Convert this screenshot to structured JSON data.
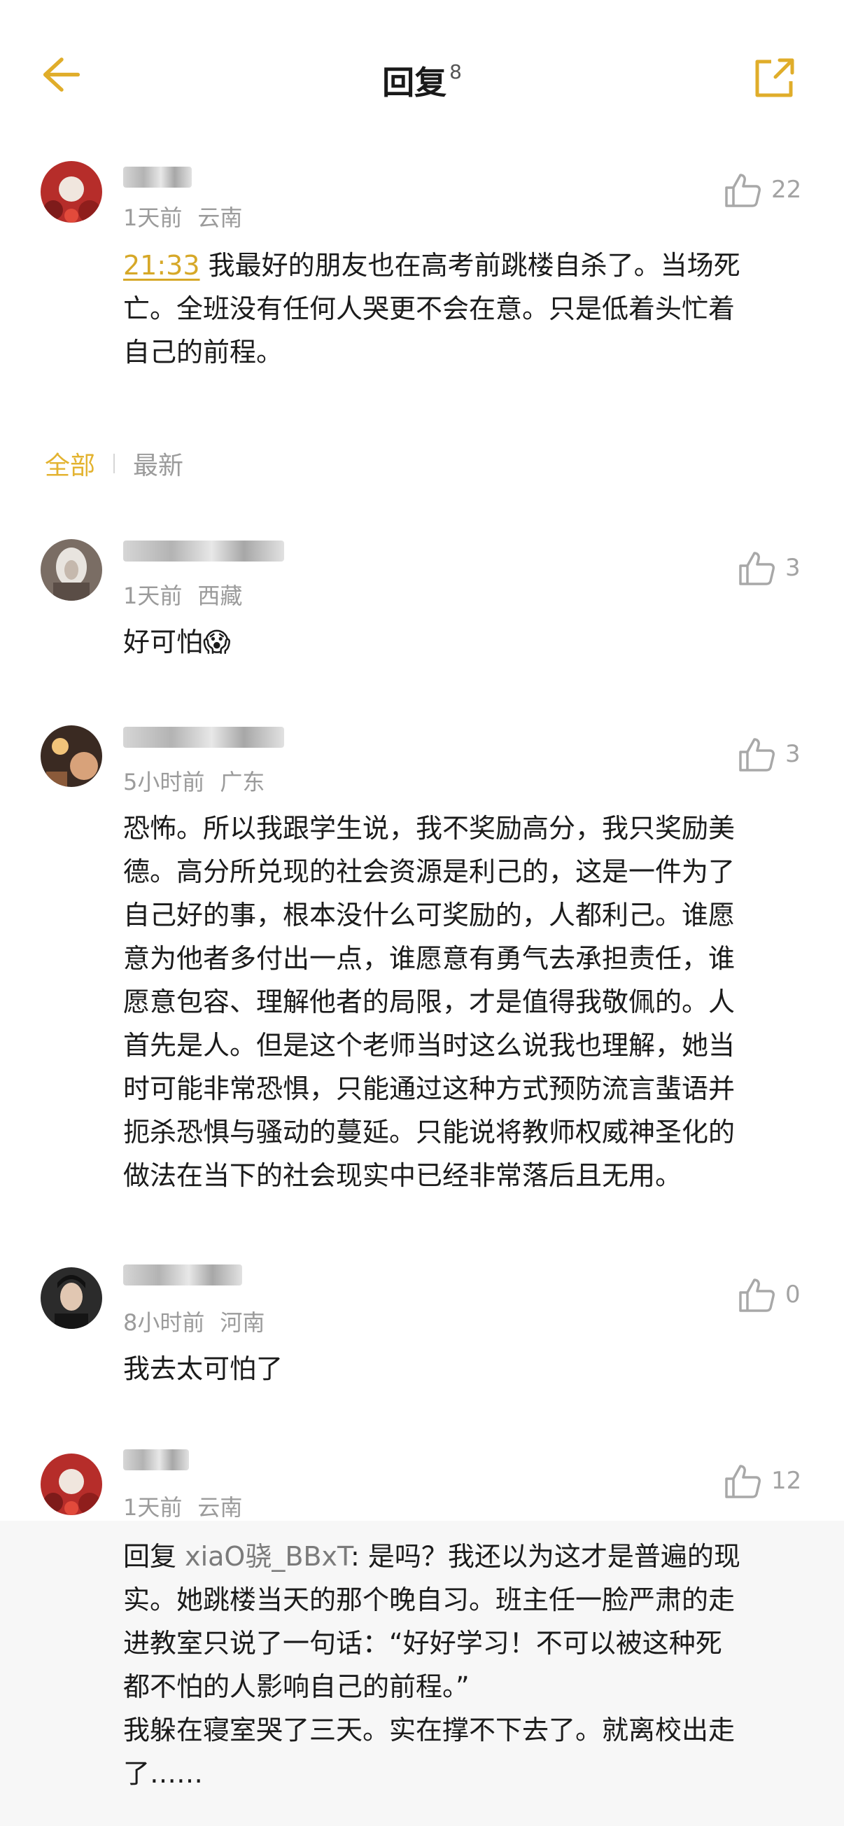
{
  "header": {
    "title": "回复",
    "count": "8"
  },
  "main_comment": {
    "time": "1天前",
    "location": "云南",
    "likes": "22",
    "timestamp": "21:33",
    "text": " 我最好的朋友也在高考前跳楼自杀了。当场死\n亡。全班没有任何人哭更不会在意。只是低着头忙着\n自己的前程。"
  },
  "tabs": {
    "all": "全部",
    "latest": "最新"
  },
  "replies": [
    {
      "time": "1天前",
      "location": "西藏",
      "likes": "3",
      "text": "好可怕😱"
    },
    {
      "time": "5小时前",
      "location": "广东",
      "likes": "3",
      "text": "恐怖。所以我跟学生说，我不奖励高分，我只奖励美\n德。高分所兑现的社会资源是利己的，这是一件为了\n自己好的事，根本没什么可奖励的，人都利己。谁愿\n意为他者多付出一点，谁愿意有勇气去承担责任，谁\n愿意包容、理解他者的局限，才是值得我敬佩的。人\n首先是人。但是这个老师当时这么说我也理解，她当\n时可能非常恐惧，只能通过这种方式预防流言蜚语并\n扼杀恐惧与骚动的蔓延。只能说将教师权威神圣化的\n做法在当下的社会现实中已经非常落后且无用。"
    },
    {
      "time": "8小时前",
      "location": "河南",
      "likes": "0",
      "text": "我去太可怕了"
    },
    {
      "time": "1天前",
      "location": "云南",
      "likes": "12",
      "reply_prefix": "回复 ",
      "reply_to": "xiaO骁_BBxT",
      "text": ": 是吗？我还以为这才是普遍的现\n实。她跳楼当天的那个晚自习。班主任一脸严肃的走\n进教室只说了一句话：“好好学习！不可以被这种死\n都不怕的人影响自己的前程。”\n我躲在寝室哭了三天。实在撑不下去了。就离校出走\n了……"
    }
  ],
  "colors": {
    "accent": "#E3B330",
    "meta": "#9B9B9B",
    "reply_bg": "#F7F7F7"
  },
  "icons": [
    "back-arrow-icon",
    "share-icon",
    "thumbs-up-icon"
  ]
}
